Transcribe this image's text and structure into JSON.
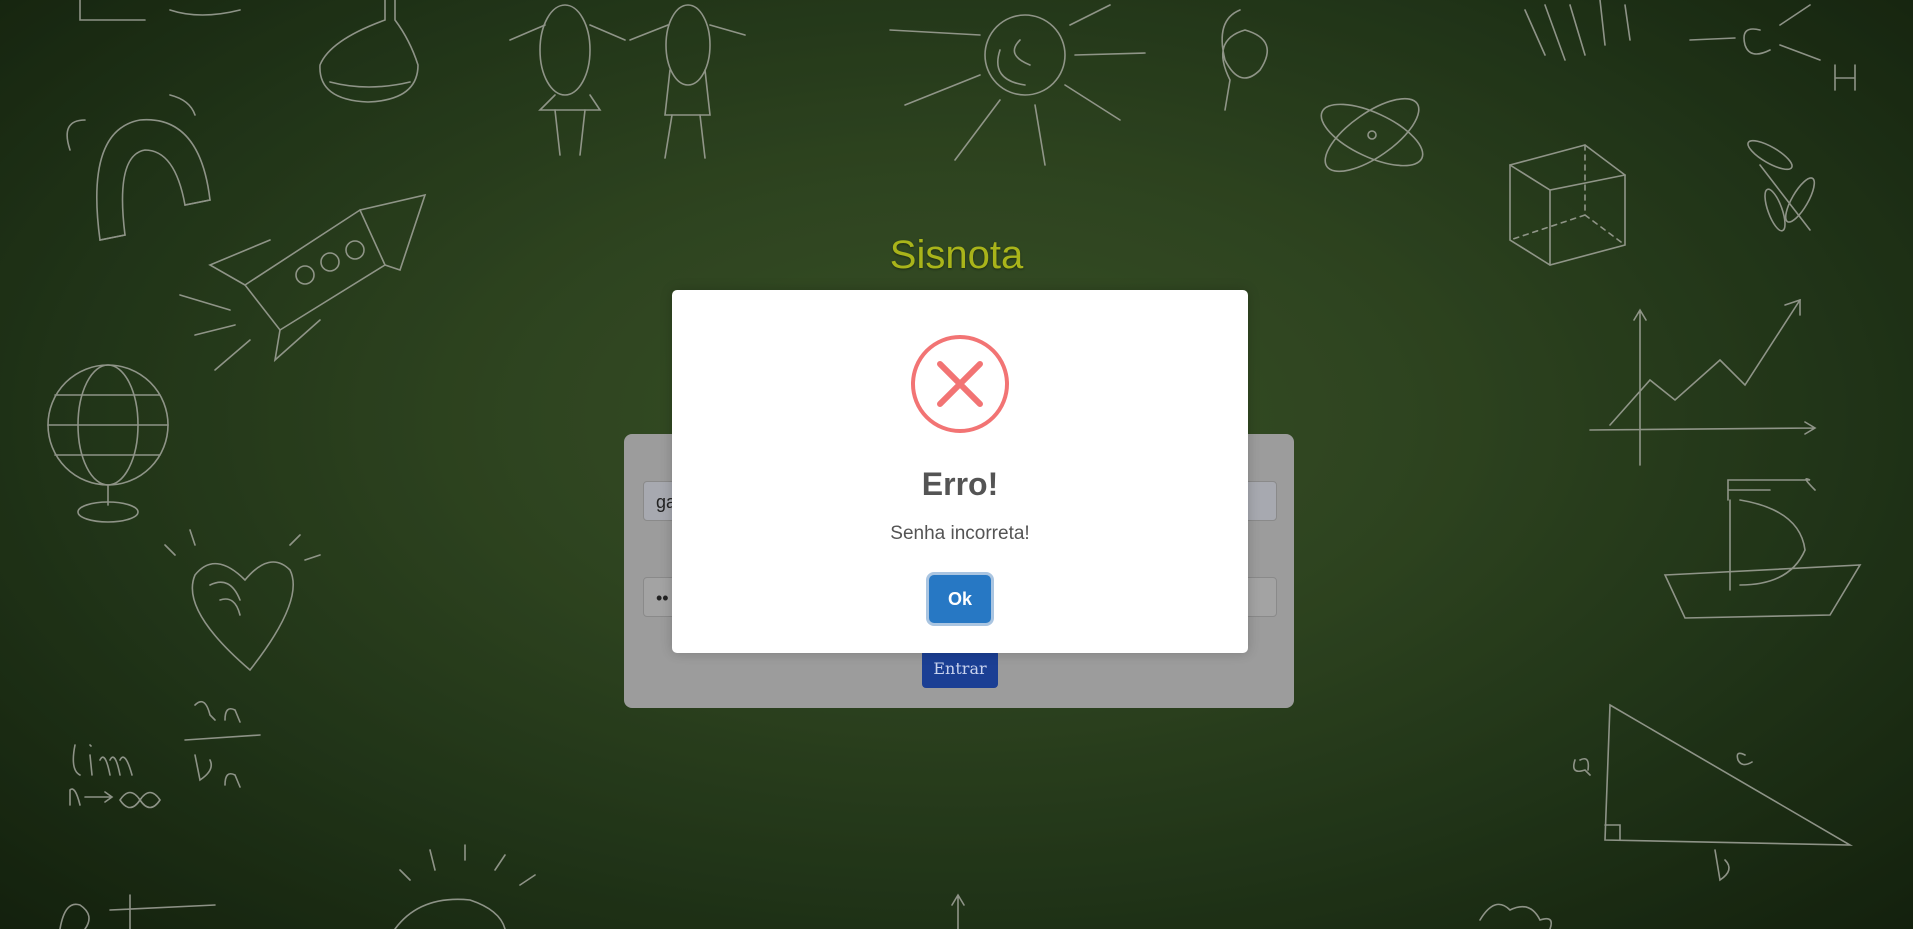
{
  "app": {
    "title": "Sisnota"
  },
  "login": {
    "username_value": "ga",
    "password_value": "••",
    "submit_label": "Entrar"
  },
  "alert": {
    "icon": "error-x-icon",
    "title": "Erro!",
    "message": "Senha incorreta!",
    "confirm_label": "Ok"
  },
  "colors": {
    "title": "#a9b41a",
    "error_icon": "#f27474",
    "confirm_button": "#2778c4",
    "submit_button": "#1b3f94"
  }
}
